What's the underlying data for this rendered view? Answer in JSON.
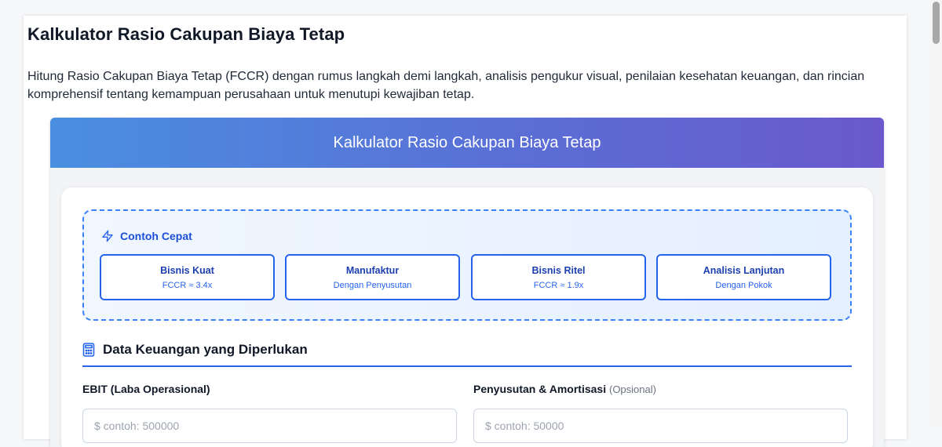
{
  "page": {
    "title": "Kalkulator Rasio Cakupan Biaya Tetap",
    "intro": "Hitung Rasio Cakupan Biaya Tetap (FCCR) dengan rumus langkah demi langkah, analisis pengukur visual, penilaian kesehatan keuangan, dan rincian komprehensif tentang kemampuan perusahaan untuk menutupi kewajiban tetap."
  },
  "calculator": {
    "header": "Kalkulator Rasio Cakupan Biaya Tetap",
    "quick_examples": {
      "title": "Contoh Cepat",
      "icon": "lightning-icon",
      "items": [
        {
          "name": "Bisnis Kuat",
          "sub": "FCCR ≈ 3.4x"
        },
        {
          "name": "Manufaktur",
          "sub": "Dengan Penyusutan"
        },
        {
          "name": "Bisnis Ritel",
          "sub": "FCCR ≈ 1.9x"
        },
        {
          "name": "Analisis Lanjutan",
          "sub": "Dengan Pokok"
        }
      ]
    },
    "section": {
      "title": "Data Keuangan yang Diperlukan",
      "icon": "calculator-icon"
    },
    "fields": {
      "ebit": {
        "label": "EBIT (Laba Operasional)",
        "placeholder": "$ contoh: 500000"
      },
      "depreciation": {
        "label": "Penyusutan & Amortisasi",
        "optional": "(Opsional)",
        "placeholder": "$ contoh: 50000"
      }
    }
  },
  "colors": {
    "accent": "#2563eb",
    "header_gradient_start": "#4a8fe0",
    "header_gradient_end": "#6a58cc"
  }
}
